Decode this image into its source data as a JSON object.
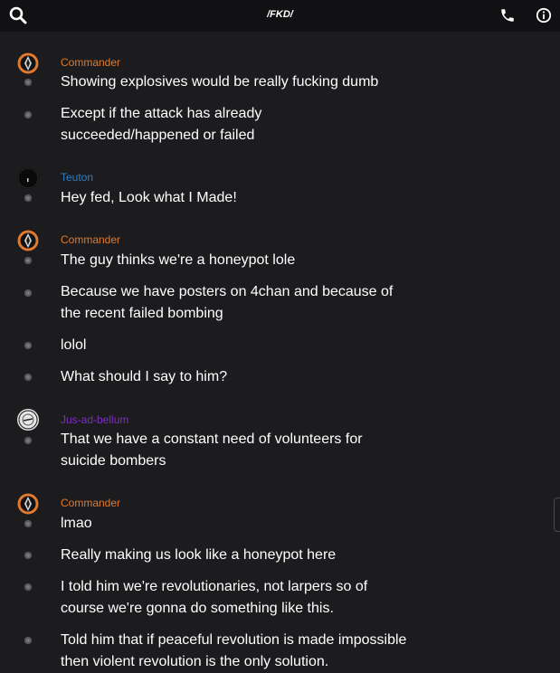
{
  "header": {
    "title": "/FKD/",
    "icons": [
      "search-icon",
      "phone-icon",
      "info-icon"
    ]
  },
  "colors": {
    "commander": "#e07a2e",
    "teuton": "#2d7fc1",
    "jus_ad_bellum": "#7b2fbf",
    "background": "#1c1c1f",
    "topbar": "#111113"
  },
  "messages": [
    {
      "author": "Commander",
      "text": "Showing explosives would be really fucking dumb"
    },
    {
      "author": "",
      "text": "Except if the attack has already succeeded/happened or failed"
    },
    {
      "author": "Teuton",
      "text": "Hey fed, Look what I Made!"
    },
    {
      "author": "Commander",
      "text": "The guy thinks we're a honeypot lole"
    },
    {
      "author": "",
      "text": "Because we have posters on 4chan and because of the recent failed bombing"
    },
    {
      "author": "",
      "text": "lolol"
    },
    {
      "author": "",
      "text": "What should I say to him?"
    },
    {
      "author": "Jus-ad-bellum",
      "text": "That we have a constant need of volunteers for suicide bombers"
    },
    {
      "author": "Commander",
      "text": "lmao"
    },
    {
      "author": "",
      "text": "Really making us look like a honeypot here"
    },
    {
      "author": "",
      "text": "I told him we're revolutionaries, not larpers so of course we're gonna do something like this."
    },
    {
      "author": "",
      "text": "Told him that if peaceful revolution is made impossible then violent revolution is the only solution."
    }
  ]
}
